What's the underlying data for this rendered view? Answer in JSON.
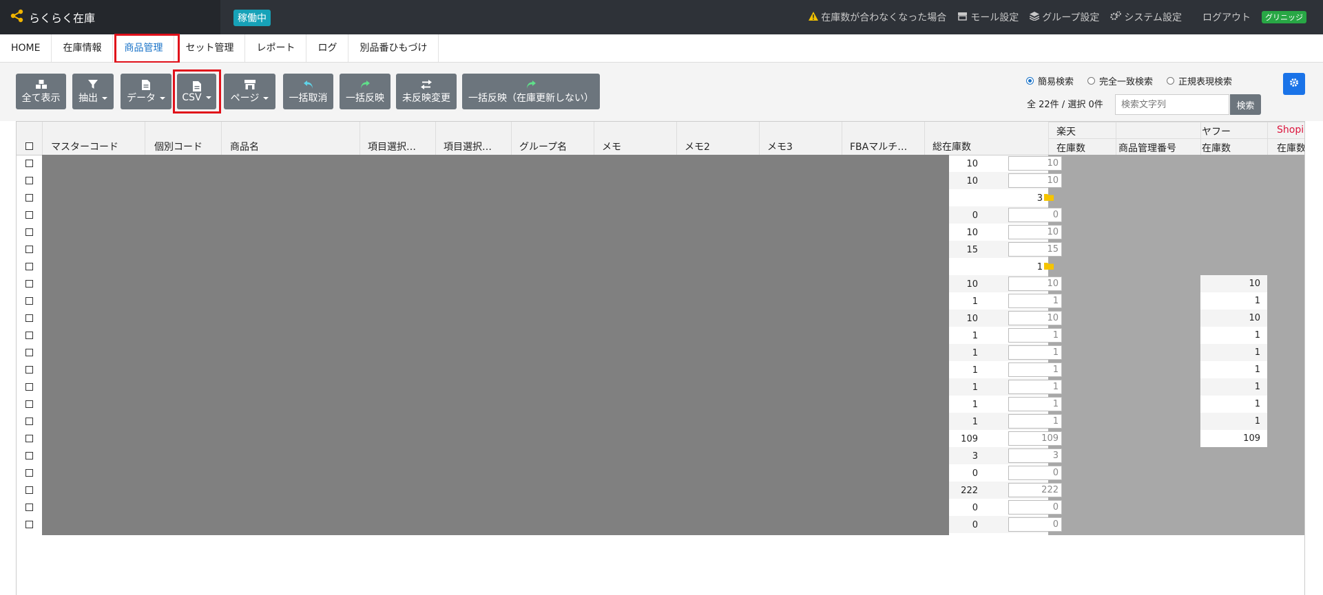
{
  "app": {
    "title": "らくらく在庫",
    "status_badge": "稼働中"
  },
  "topnav": {
    "alert": "在庫数が合わなくなった場合",
    "mall_settings": "モール設定",
    "group_settings": "グループ設定",
    "system_settings": "システム設定",
    "logout": "ログアウト",
    "user": "グリニッジ"
  },
  "tabs": [
    "HOME",
    "在庫情報",
    "商品管理",
    "セット管理",
    "レポート",
    "ログ",
    "別品番ひもづけ"
  ],
  "active_tab": "商品管理",
  "toolbar": {
    "show_all": "全て表示",
    "extract": "抽出",
    "data": "データ",
    "csv": "CSV",
    "page": "ページ",
    "undo_all": "一括取消",
    "apply_all": "一括反映",
    "unapplied_changes": "未反映変更",
    "apply_no_update": "一括反映（在庫更新しない）"
  },
  "search": {
    "modes": [
      "簡易検索",
      "完全一致検索",
      "正規表現検索"
    ],
    "selected_mode": "簡易検索",
    "count_text": "全 22件 / 選択 0件",
    "placeholder": "検索文字列",
    "button": "検索"
  },
  "table": {
    "columns": [
      "マスターコード",
      "個別コード",
      "商品名",
      "項目選択…",
      "項目選択…",
      "グループ名",
      "メモ",
      "メモ2",
      "メモ3",
      "FBAマルチ…",
      "総在庫数"
    ],
    "mall_groups": [
      "楽天",
      "ヤフー",
      "Shopi"
    ],
    "mall_subcolumns": [
      "在庫数",
      "商品管理番号",
      "在庫数",
      "在庫数"
    ],
    "rows": [
      {
        "total": "10",
        "input": "10"
      },
      {
        "total": "10",
        "input": "10"
      },
      {
        "folder": "3"
      },
      {
        "total": "0",
        "input": "0"
      },
      {
        "total": "10",
        "input": "10"
      },
      {
        "total": "15",
        "input": "15"
      },
      {
        "folder": "1"
      },
      {
        "total": "10",
        "input": "10",
        "yahoo": "10"
      },
      {
        "total": "1",
        "input": "1",
        "yahoo": "1"
      },
      {
        "total": "10",
        "input": "10",
        "yahoo": "10"
      },
      {
        "total": "1",
        "input": "1",
        "yahoo": "1"
      },
      {
        "total": "1",
        "input": "1",
        "yahoo": "1"
      },
      {
        "total": "1",
        "input": "1",
        "yahoo": "1"
      },
      {
        "total": "1",
        "input": "1",
        "yahoo": "1"
      },
      {
        "total": "1",
        "input": "1",
        "yahoo": "1"
      },
      {
        "total": "1",
        "input": "1",
        "yahoo": "1"
      },
      {
        "total": "109",
        "input": "109",
        "yahoo": "109"
      },
      {
        "total": "3",
        "input": "3"
      },
      {
        "total": "0",
        "input": "0"
      },
      {
        "total": "222",
        "input": "222"
      },
      {
        "total": "0",
        "input": "0"
      },
      {
        "total": "0",
        "input": "0"
      }
    ]
  },
  "colors": {
    "topbar": "#2e3238",
    "accent": "#1a73c8",
    "highlight": "#e0101a",
    "status": "#17a2b8",
    "shopify": "#dc143c"
  }
}
